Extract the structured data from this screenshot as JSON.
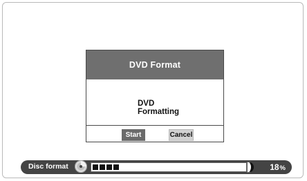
{
  "dialog": {
    "title": "DVD Format",
    "message_line1": "DVD",
    "message_line2": "Formatting",
    "start_label": "Start",
    "cancel_label": "Cancel"
  },
  "status_bar": {
    "label": "Disc format",
    "icon": "disc-icon",
    "progress_value": "18",
    "progress_unit": "%",
    "progress_fraction": 0.18
  },
  "colors": {
    "dialog_title_bg": "#6f6f6f",
    "start_button_bg": "#6b6b6b",
    "status_bar_bg": "#444444"
  }
}
